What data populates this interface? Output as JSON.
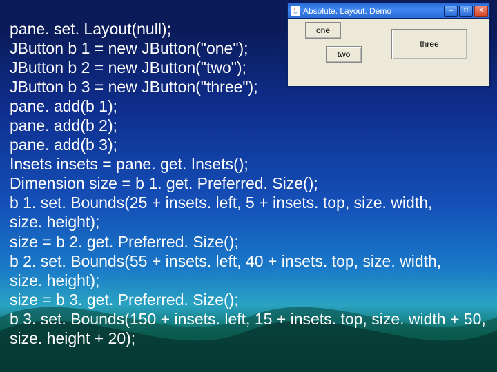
{
  "code_lines": [
    "pane. set. Layout(null);",
    "JButton b 1 = new JButton(\"one\");",
    "JButton b 2 = new JButton(\"two\");",
    "JButton b 3 = new JButton(\"three\");",
    "pane. add(b 1);",
    "pane. add(b 2);",
    "pane. add(b 3);",
    "Insets insets = pane. get. Insets();",
    "Dimension size = b 1. get. Preferred. Size();",
    "b 1. set. Bounds(25 + insets. left, 5 + insets. top, size. width,",
    "size. height);",
    "size = b 2. get. Preferred. Size();",
    "b 2. set. Bounds(55 + insets. left, 40 + insets. top, size. width,",
    "size. height);",
    "size = b 3. get. Preferred. Size();",
    "b 3. set. Bounds(150 + insets. left, 15 + insets. top, size. width + 50,",
    "size. height + 20);"
  ],
  "window": {
    "title": "Absolute. Layout. Demo",
    "buttons": {
      "b1": "one",
      "b2": "two",
      "b3": "three"
    }
  },
  "title_icons": {
    "minimize": "–",
    "maximize": "□",
    "close": "X"
  }
}
